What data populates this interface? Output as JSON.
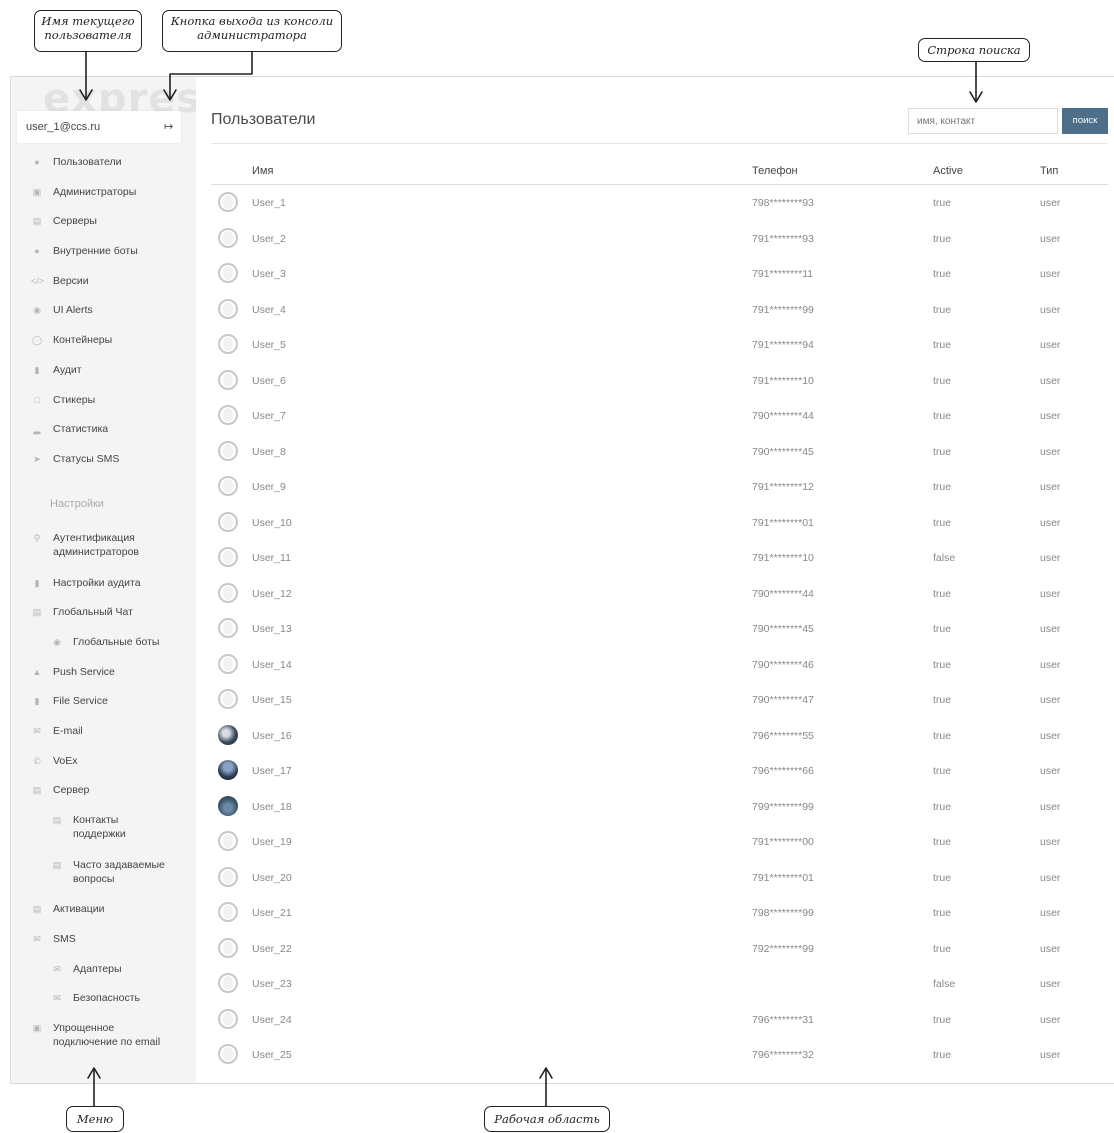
{
  "callouts": {
    "username": "Имя текущего пользователя",
    "exit_button": "Кнопка выхода из консоли администратора",
    "search": "Строка поиска",
    "menu": "Меню",
    "workspace": "Рабочая область"
  },
  "logo": "express",
  "user": {
    "email": "user_1@ccs.ru",
    "exit_icon": "sign-out-icon"
  },
  "sidebar": {
    "items": [
      {
        "label": "Пользователи",
        "icon": "user-icon"
      },
      {
        "label": "Администраторы",
        "icon": "id-card-icon"
      },
      {
        "label": "Серверы",
        "icon": "server-icon"
      },
      {
        "label": "Внутренние боты",
        "icon": "bots-icon"
      },
      {
        "label": "Версии",
        "icon": "code-icon"
      },
      {
        "label": "UI Alerts",
        "icon": "alert-icon"
      },
      {
        "label": "Контейнеры",
        "icon": "container-icon"
      },
      {
        "label": "Аудит",
        "icon": "shield-icon"
      },
      {
        "label": "Стикеры",
        "icon": "sticker-icon"
      },
      {
        "label": "Статистика",
        "icon": "bar-chart-icon"
      },
      {
        "label": "Статусы SMS",
        "icon": "send-icon"
      }
    ],
    "settings_header": "Настройки",
    "settings_items": [
      {
        "label": "Аутентификация администраторов",
        "icon": "key-icon"
      },
      {
        "label": "Настройки аудита",
        "icon": "shield-icon"
      },
      {
        "label": "Глобальный Чат",
        "icon": "list-icon"
      },
      {
        "label": "Глобальные боты",
        "icon": "globe-icon"
      },
      {
        "label": "Push Service",
        "icon": "bell-icon"
      },
      {
        "label": "File Service",
        "icon": "file-icon"
      },
      {
        "label": "E-mail",
        "icon": "envelope-icon"
      },
      {
        "label": "VoEx",
        "icon": "phone-icon"
      },
      {
        "label": "Сервер",
        "icon": "list-icon"
      },
      {
        "label": "Контакты поддержки",
        "icon": "list-icon"
      },
      {
        "label": "Часто задаваемые вопросы",
        "icon": "list-icon"
      },
      {
        "label": "Активации",
        "icon": "list-icon"
      },
      {
        "label": "SMS",
        "icon": "envelope-icon"
      },
      {
        "label": "Адаптеры",
        "icon": "envelope-icon"
      },
      {
        "label": "Безопасность",
        "icon": "envelope-icon"
      },
      {
        "label": "Упрощенное подключение по email",
        "icon": "card-icon"
      }
    ]
  },
  "main": {
    "title": "Пользователи",
    "search_placeholder": "имя, контакт",
    "search_button": "поиск",
    "columns": [
      "Имя",
      "Телефон",
      "Active",
      "Тип"
    ],
    "rows": [
      {
        "name": "User_1",
        "phone": "798********93",
        "active": "true",
        "type": "user"
      },
      {
        "name": "User_2",
        "phone": "791********93",
        "active": "true",
        "type": "user"
      },
      {
        "name": "User_3",
        "phone": "791********11",
        "active": "true",
        "type": "user"
      },
      {
        "name": "User_4",
        "phone": "791********99",
        "active": "true",
        "type": "user"
      },
      {
        "name": "User_5",
        "phone": "791********94",
        "active": "true",
        "type": "user"
      },
      {
        "name": "User_6",
        "phone": "791********10",
        "active": "true",
        "type": "user"
      },
      {
        "name": "User_7",
        "phone": "790********44",
        "active": "true",
        "type": "user"
      },
      {
        "name": "User_8",
        "phone": "790********45",
        "active": "true",
        "type": "user"
      },
      {
        "name": "User_9",
        "phone": "791********12",
        "active": "true",
        "type": "user"
      },
      {
        "name": "User_10",
        "phone": "791********01",
        "active": "true",
        "type": "user"
      },
      {
        "name": "User_11",
        "phone": "791********10",
        "active": "false",
        "type": "user"
      },
      {
        "name": "User_12",
        "phone": "790********44",
        "active": "true",
        "type": "user"
      },
      {
        "name": "User_13",
        "phone": "790********45",
        "active": "true",
        "type": "user"
      },
      {
        "name": "User_14",
        "phone": "790********46",
        "active": "true",
        "type": "user"
      },
      {
        "name": "User_15",
        "phone": "790********47",
        "active": "true",
        "type": "user"
      },
      {
        "name": "User_16",
        "phone": "796********55",
        "active": "true",
        "type": "user"
      },
      {
        "name": "User_17",
        "phone": "796********66",
        "active": "true",
        "type": "user"
      },
      {
        "name": "User_18",
        "phone": "799********99",
        "active": "true",
        "type": "user"
      },
      {
        "name": "User_19",
        "phone": "791********00",
        "active": "true",
        "type": "user"
      },
      {
        "name": "User_20",
        "phone": "791********01",
        "active": "true",
        "type": "user"
      },
      {
        "name": "User_21",
        "phone": "798********99",
        "active": "true",
        "type": "user"
      },
      {
        "name": "User_22",
        "phone": "792********99",
        "active": "true",
        "type": "user"
      },
      {
        "name": "User_23",
        "phone": "",
        "active": "false",
        "type": "user"
      },
      {
        "name": "User_24",
        "phone": "796********31",
        "active": "true",
        "type": "user"
      },
      {
        "name": "User_25",
        "phone": "796********32",
        "active": "true",
        "type": "user"
      }
    ]
  },
  "colors": {
    "search_button": "#4d6f8a",
    "sidebar_bg": "#f4f4f4"
  }
}
